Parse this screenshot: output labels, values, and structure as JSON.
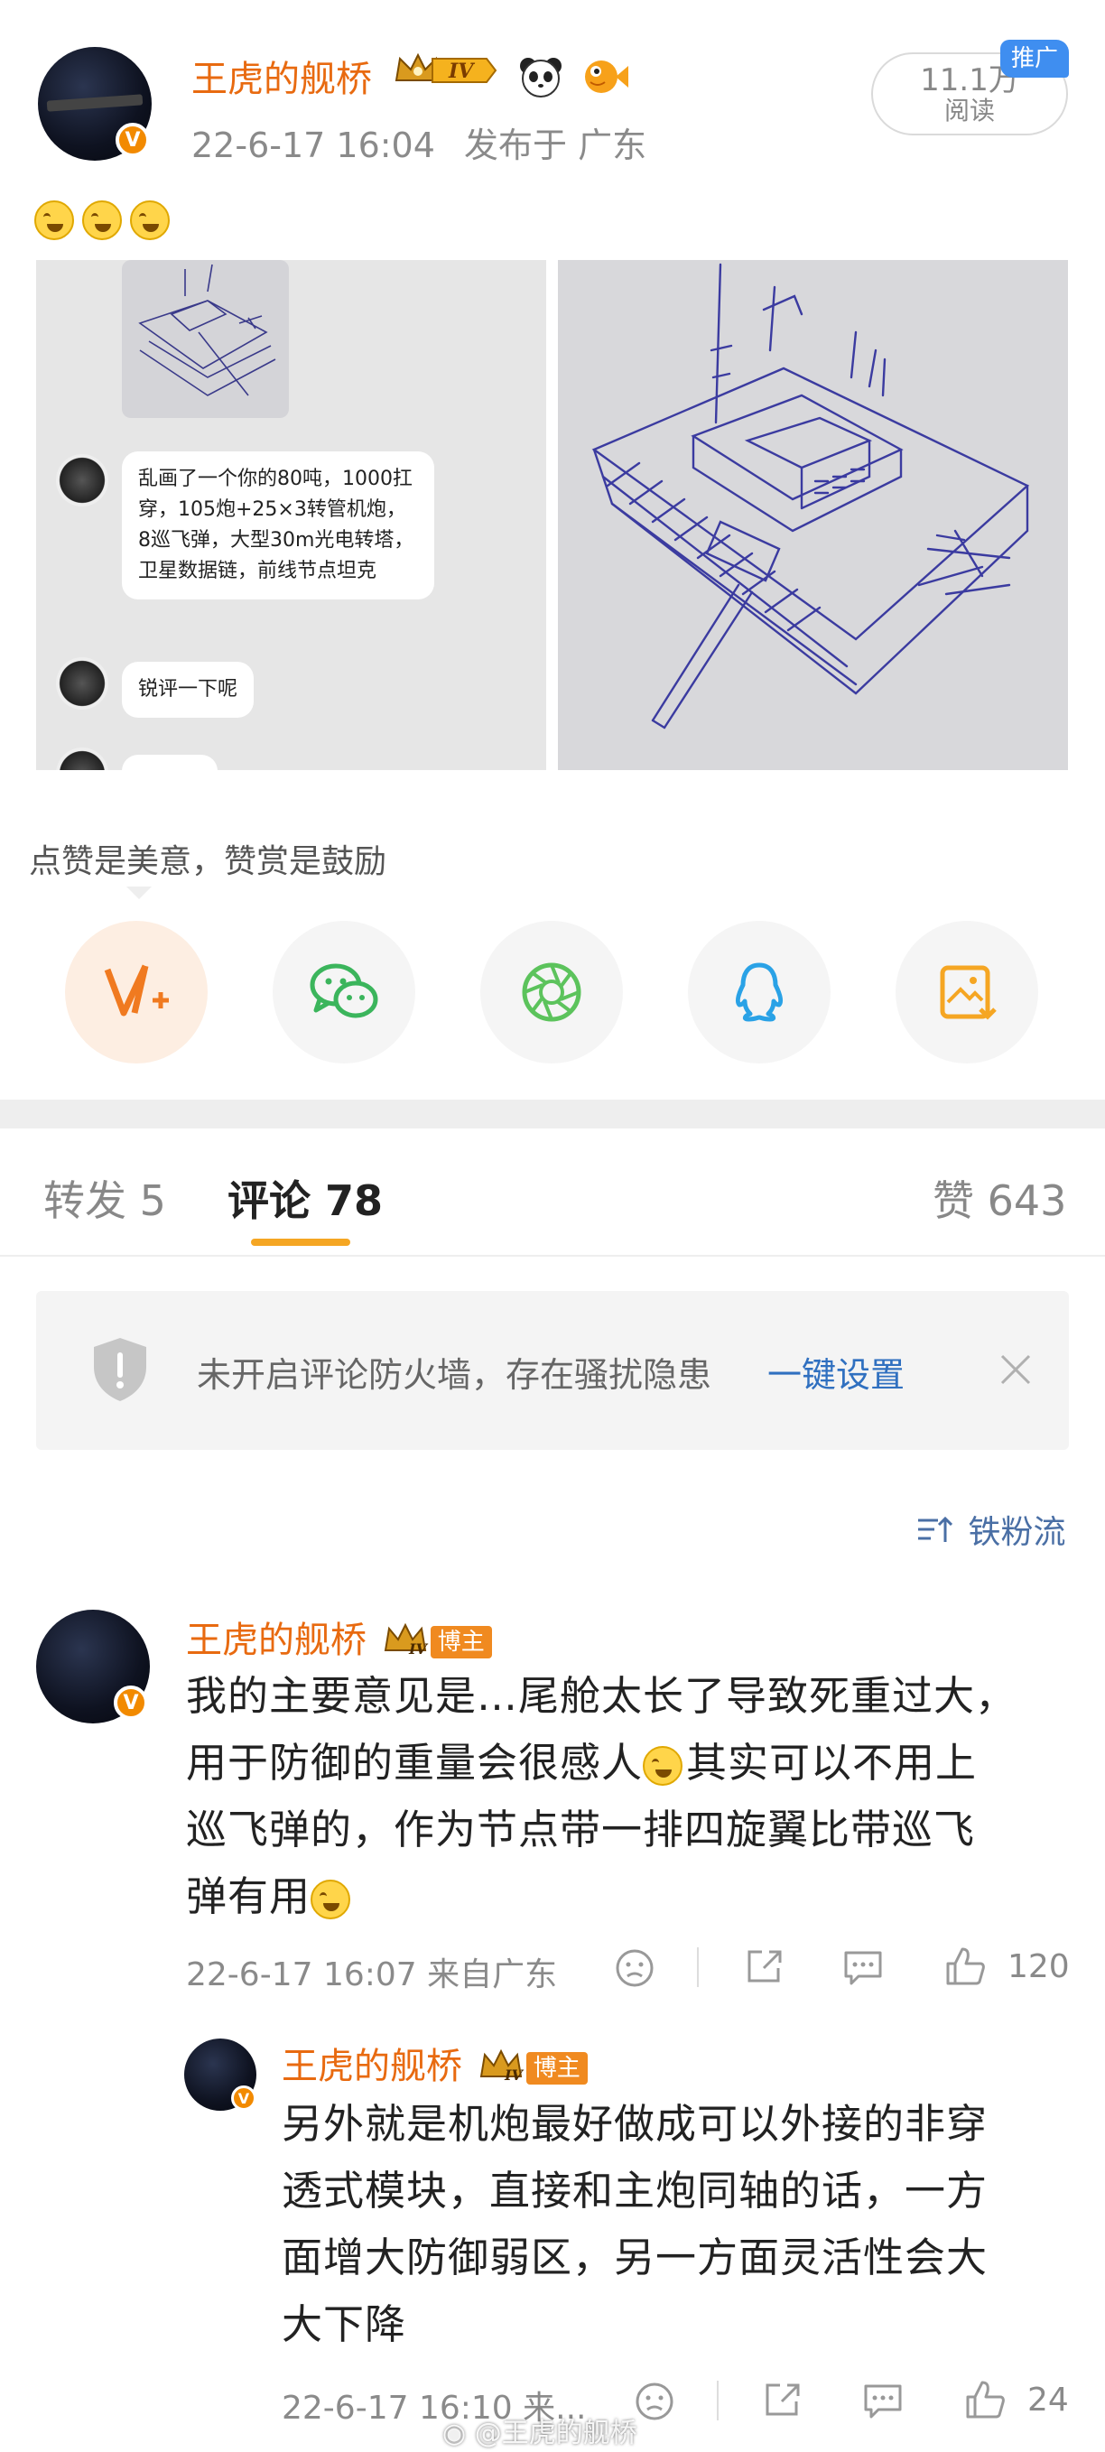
{
  "post": {
    "author": "王虎的舰桥",
    "level": "IV",
    "time": "22-6-17 16:04",
    "location": "发布于 广东",
    "reads_count": "11.1万",
    "reads_label": "阅读",
    "promo_tag": "推广"
  },
  "images": {
    "chat_messages": [
      "乱画了一个你的80吨，1000扛穿，105炮+25×3转管机炮，8巡飞弹，大型30m光电转塔，卫星数据链，前线节点坦克",
      "锐评一下呢"
    ]
  },
  "reward": {
    "text": "点赞是美意，赞赏是鼓励",
    "actions": [
      "vplus-icon",
      "wechat-icon",
      "moments-icon",
      "qq-icon",
      "save-image-icon"
    ]
  },
  "tabs": {
    "repost": "转发 5",
    "comments": "评论 78",
    "likes": "赞 643"
  },
  "banner": {
    "text": "未开启评论防火墙，存在骚扰隐患",
    "link": "一键设置"
  },
  "filter": {
    "label": "铁粉流"
  },
  "comments": [
    {
      "author": "王虎的舰桥",
      "level": "IV",
      "badge": "博主",
      "lines": [
        "我的主要意见是…尾舱太长了导致死重过大，",
        "用于防御的重量会很感人",
        "其实可以不用上",
        "巡飞弹的，作为节点带一排四旋翼比带巡飞",
        "弹有用"
      ],
      "time": "22-6-17 16:07 来自广东",
      "likes": "120"
    },
    {
      "author": "王虎的舰桥",
      "level": "IV",
      "badge": "博主",
      "lines": [
        "另外就是机炮最好做成可以外接的非穿",
        "透式模块，直接和主炮同轴的话，一方",
        "面增大防御弱区，另一方面灵活性会大",
        "大下降"
      ],
      "time": "22-6-17 16:10 来...",
      "likes": "24"
    }
  ],
  "watermark": "@王虎的舰桥",
  "colors": {
    "name_orange": "#e86a10",
    "link_blue": "#3070c0",
    "accent_underline": "#f5a623"
  }
}
